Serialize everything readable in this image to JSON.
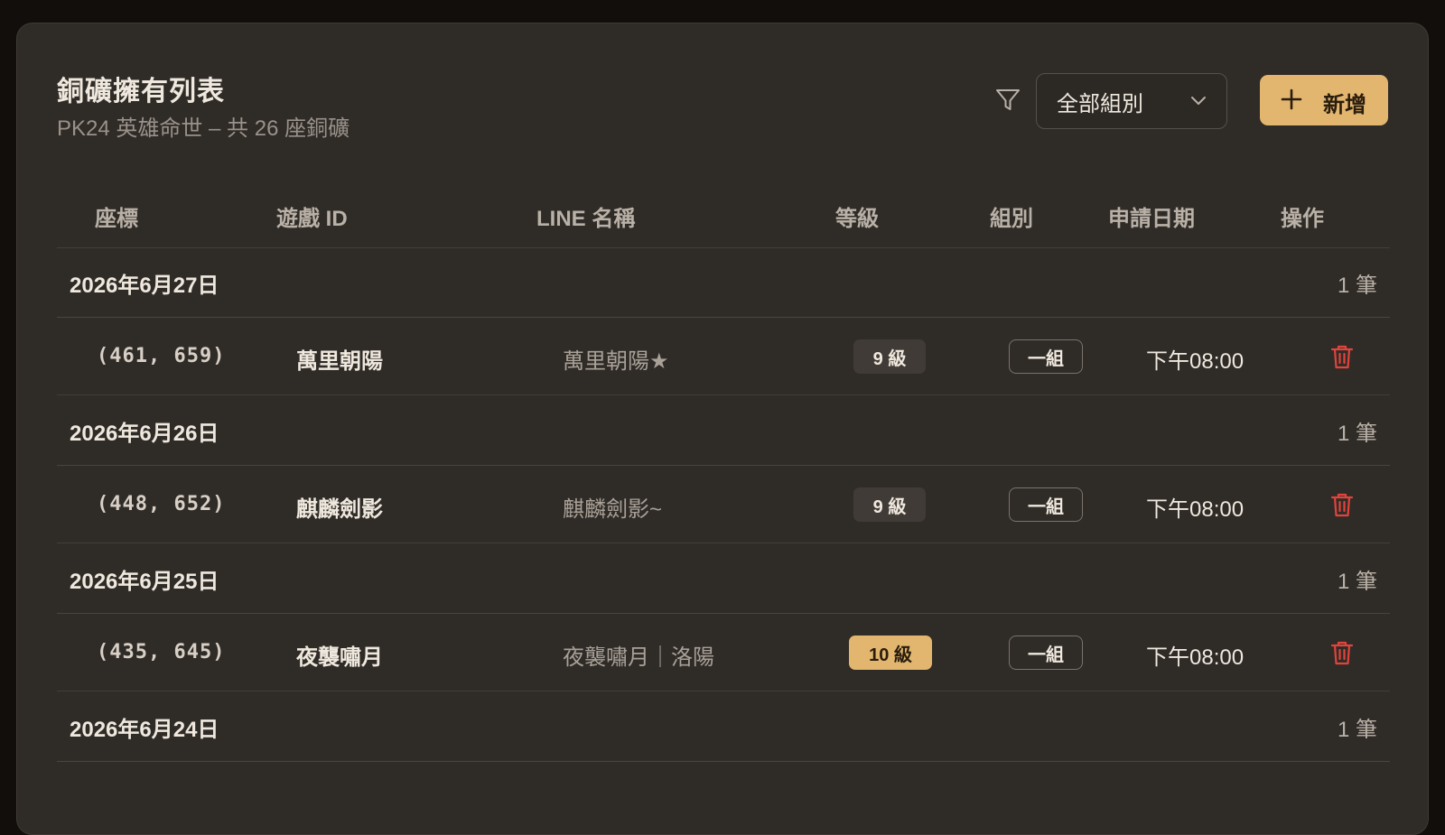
{
  "header": {
    "title": "銅礦擁有列表",
    "subtitle": "PK24 英雄命世 – 共 26 座銅礦"
  },
  "toolbar": {
    "filter_icon": "filter-icon",
    "group_select_value": "全部組別",
    "add_label": "新增"
  },
  "table": {
    "headers": [
      "座標",
      "遊戲 ID",
      "LINE 名稱",
      "等級",
      "組別",
      "申請日期",
      "操作"
    ],
    "groups": [
      {
        "date": "2026年6月27日",
        "count": "1 筆",
        "rows": [
          {
            "coord": "(461, 659)",
            "game_id": "萬里朝陽",
            "line_name": "萬里朝陽★",
            "level": "9 級",
            "level_highlight": false,
            "group": "一組",
            "time": "下午08:00"
          }
        ]
      },
      {
        "date": "2026年6月26日",
        "count": "1 筆",
        "rows": [
          {
            "coord": "(448, 652)",
            "game_id": "麒麟劍影",
            "line_name": "麒麟劍影~",
            "level": "9 級",
            "level_highlight": false,
            "group": "一組",
            "time": "下午08:00"
          }
        ]
      },
      {
        "date": "2026年6月25日",
        "count": "1 筆",
        "rows": [
          {
            "coord": "(435, 645)",
            "game_id": "夜襲嘯月",
            "line_name": "夜襲嘯月｜洛陽",
            "level": "10 級",
            "level_highlight": true,
            "group": "一組",
            "time": "下午08:00"
          }
        ]
      },
      {
        "date": "2026年6月24日",
        "count": "1 筆",
        "rows": []
      }
    ]
  },
  "colors": {
    "accent": "#e2b66e",
    "danger": "#e0443c",
    "panel": "#2f2b27"
  }
}
